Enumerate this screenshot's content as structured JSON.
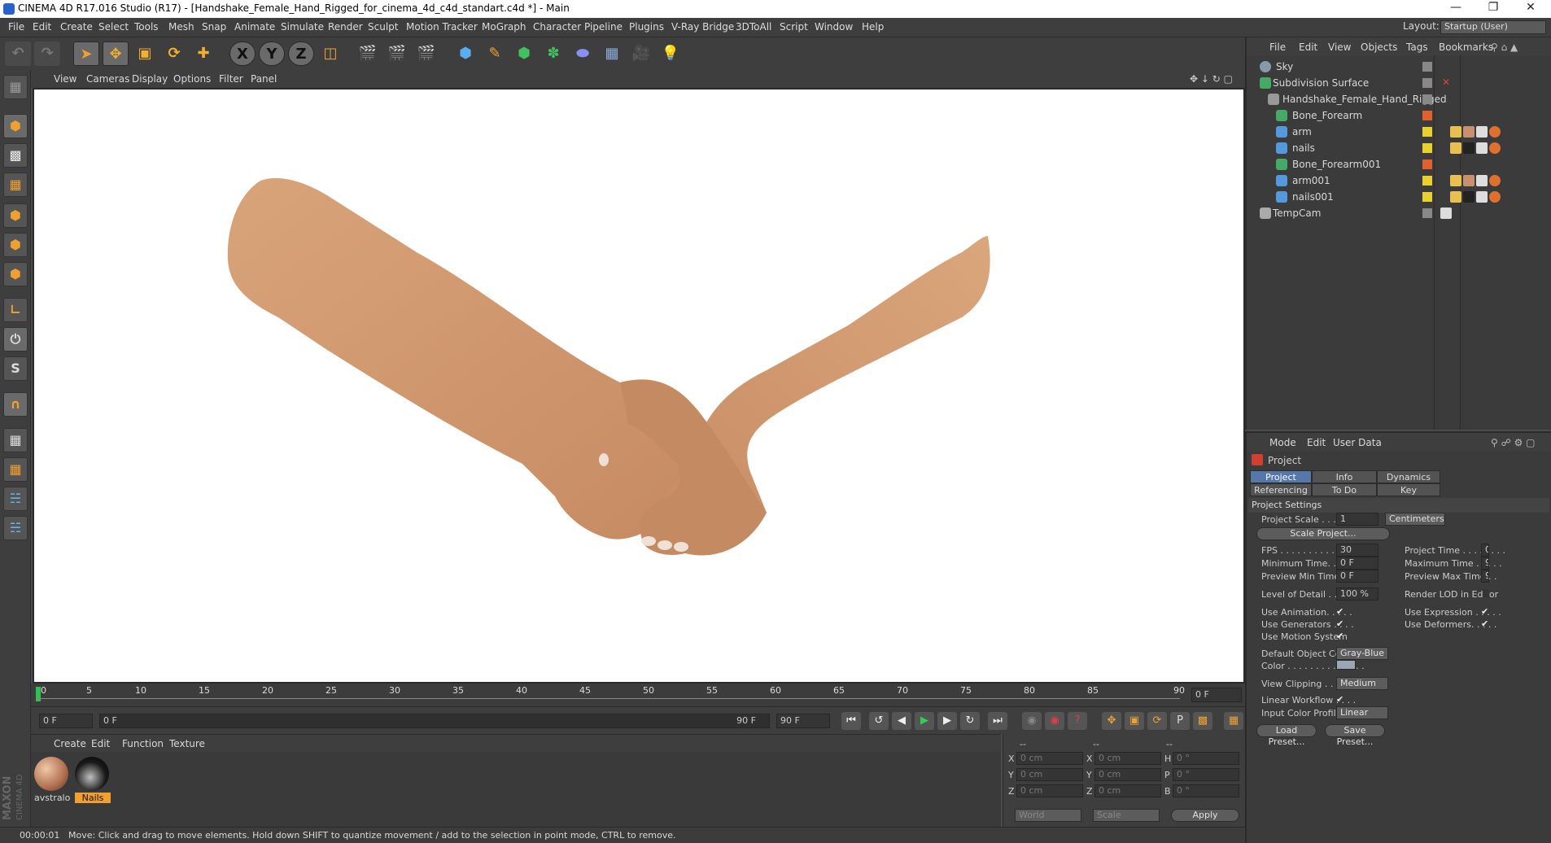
{
  "window": {
    "title": "CINEMA 4D R17.016 Studio (R17) - [Handshake_Female_Hand_Rigged_for_cinema_4d_c4d_standart.c4d *] - Main",
    "minimize": "—",
    "restore": "❐",
    "close": "✕"
  },
  "menu": [
    "File",
    "Edit",
    "Create",
    "Select",
    "Tools",
    "Mesh",
    "Snap",
    "Animate",
    "Simulate",
    "Render",
    "Sculpt",
    "Motion Tracker",
    "MoGraph",
    "Character",
    "Pipeline",
    "Plugins",
    "V-Ray Bridge",
    "3DToAll",
    "Script",
    "Window",
    "Help"
  ],
  "layout": {
    "label": "Layout:",
    "value": "Startup (User)"
  },
  "toolbar": {
    "x": "X",
    "y": "Y",
    "z": "Z"
  },
  "view_menu": [
    "View",
    "Cameras",
    "Display",
    "Options",
    "Filter",
    "Panel"
  ],
  "timeline": {
    "ticks": [
      "0",
      "5",
      "10",
      "15",
      "20",
      "25",
      "30",
      "35",
      "40",
      "45",
      "50",
      "55",
      "60",
      "65",
      "70",
      "75",
      "80",
      "85",
      "90"
    ],
    "end_field": "0 F"
  },
  "playback": {
    "current": "0 F",
    "range_start": "0 F",
    "range_end": "90 F",
    "max": "90 F"
  },
  "material_menu": [
    "Create",
    "Edit",
    "Function",
    "Texture"
  ],
  "materials": [
    {
      "name": "avstralo",
      "color": "#c89070"
    },
    {
      "name": "Nails",
      "color": "#3a2a24"
    }
  ],
  "coords": {
    "headers": [
      "--",
      "--",
      "--"
    ],
    "rows": [
      {
        "a": "X",
        "av": "0 cm",
        "b": "X",
        "bv": "0 cm",
        "c": "H",
        "cv": "0 °"
      },
      {
        "a": "Y",
        "av": "0 cm",
        "b": "Y",
        "bv": "0 cm",
        "c": "P",
        "cv": "0 °"
      },
      {
        "a": "Z",
        "av": "0 cm",
        "b": "Z",
        "bv": "0 cm",
        "c": "B",
        "cv": "0 °"
      }
    ],
    "world": "World",
    "scale": "Scale",
    "apply": "Apply"
  },
  "status": {
    "time": "00:00:01",
    "message": "Move: Click and drag to move elements. Hold down SHIFT to quantize movement / add to the selection in point mode, CTRL to remove."
  },
  "brand": {
    "maxon": "MAXON",
    "c4d": "CINEMA 4D"
  },
  "object_menu": [
    "File",
    "Edit",
    "View",
    "Objects",
    "Tags",
    "Bookmarks"
  ],
  "objects": [
    {
      "name": "Sky",
      "indent": 0,
      "color": "#8899aa"
    },
    {
      "name": "Subdivision Surface",
      "indent": 0,
      "color": "#44aa66"
    },
    {
      "name": "Handshake_Female_Hand_Rigged",
      "indent": 1,
      "color": "#999999"
    },
    {
      "name": "Bone_Forearm",
      "indent": 2,
      "color": "#44aa66"
    },
    {
      "name": "arm",
      "indent": 2,
      "color": "#5599dd"
    },
    {
      "name": "nails",
      "indent": 2,
      "color": "#5599dd"
    },
    {
      "name": "Bone_Forearm001",
      "indent": 2,
      "color": "#44aa66"
    },
    {
      "name": "arm001",
      "indent": 2,
      "color": "#5599dd"
    },
    {
      "name": "nails001",
      "indent": 2,
      "color": "#5599dd"
    },
    {
      "name": "TempCam",
      "indent": 0,
      "color": "#aaaaaa"
    }
  ],
  "attr_menu": [
    "Mode",
    "Edit",
    "User Data"
  ],
  "attr": {
    "object": "Project",
    "tabs_row1": [
      "Project Settings",
      "Info",
      "Dynamics"
    ],
    "tabs_row2": [
      "Referencing",
      "To Do",
      "Key Interpolation"
    ],
    "section": "Project Settings",
    "project_scale_label": "Project Scale . . . . . .",
    "project_scale": "1",
    "project_scale_unit": "Centimeters",
    "scale_project": "Scale Project...",
    "fps_label": "FPS . . . . . . . . . . . . . . .",
    "fps": "30",
    "project_time_label": "Project Time . . . . . . . .",
    "project_time": "0",
    "min_time_label": "Minimum Time. . . . . . .",
    "min_time": "0 F",
    "max_time_label": "Maximum Time . . . . .",
    "max_time": "9",
    "prev_min_label": "Preview Min Time . . .",
    "prev_min": "0 F",
    "prev_max_label": "Preview Max Time . .",
    "prev_max": "9",
    "lod_label": "Level of Detail . . . . . .",
    "lod": "100 %",
    "render_lod_label": "Render LOD in Editor",
    "use_animation": "Use Animation. . . . .",
    "use_expression": "Use Expression . . . . .",
    "use_generators": "Use Generators . . . .",
    "use_deformers": "Use Deformers. . . . .",
    "use_motion": "Use Motion System",
    "default_color_label": "Default Object Color",
    "default_color": "Gray-Blue",
    "color_label": "Color . . . . . . . . . . . . . .",
    "view_clipping_label": "View Clipping . . . . . .",
    "view_clipping": "Medium",
    "linear_workflow_label": "Linear Workflow . . . .",
    "input_profile_label": "Input Color Profile . .",
    "input_profile": "Linear",
    "load_preset": "Load Preset...",
    "save_preset": "Save Preset...",
    "check": "✔"
  }
}
